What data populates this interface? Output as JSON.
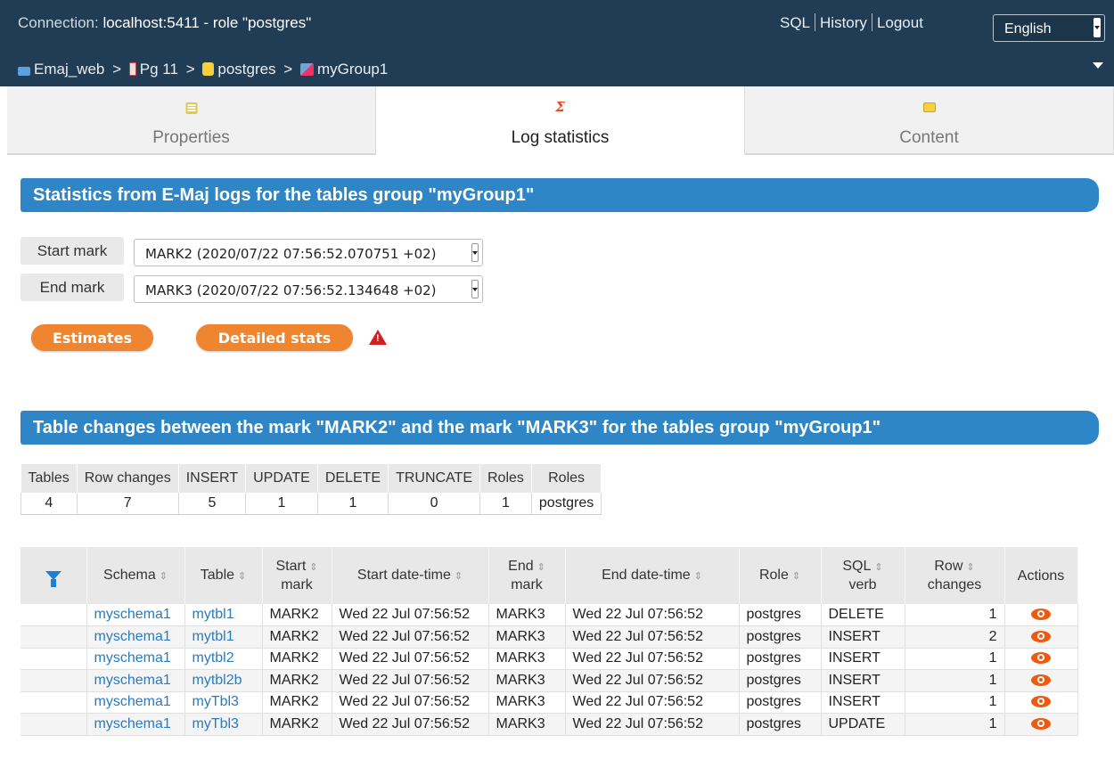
{
  "topbar": {
    "connection_prefix": "Connection: ",
    "connection_host": "localhost:5411",
    "connection_role": " - role \"postgres\"",
    "links": [
      "SQL",
      "History",
      "Logout"
    ],
    "language": "English"
  },
  "breadcrumb": {
    "items": [
      "Emaj_web",
      "Pg 11",
      "postgres",
      "myGroup1"
    ],
    "separator": ">"
  },
  "tabs": [
    {
      "label": "Properties"
    },
    {
      "label": "Log statistics"
    },
    {
      "label": "Content"
    }
  ],
  "stats_section": {
    "title": "Statistics from E-Maj logs for the tables group \"myGroup1\"",
    "start_mark_label": "Start mark",
    "start_mark_value": "MARK2 (2020/07/22 07:56:52.070751 +02)",
    "end_mark_label": "End mark",
    "end_mark_value": "MARK3 (2020/07/22 07:56:52.134648 +02)",
    "estimates_button": "Estimates",
    "detailed_button": "Detailed stats",
    "warning_icon": "warning-icon"
  },
  "changes_section": {
    "title": "Table changes between the mark \"MARK2\" and the mark \"MARK3\" for the tables group \"myGroup1\""
  },
  "summary": {
    "headers": [
      "Tables",
      "Row changes",
      "INSERT",
      "UPDATE",
      "DELETE",
      "TRUNCATE",
      "Roles",
      "Roles"
    ],
    "values": [
      "4",
      "7",
      "5",
      "1",
      "1",
      "0",
      "1",
      "postgres"
    ]
  },
  "detail": {
    "headers": {
      "schema": "Schema",
      "table": "Table",
      "start_mark_1": "Start",
      "start_mark_2": "mark",
      "start_dt": "Start date-time",
      "end_mark_1": "End",
      "end_mark_2": "mark",
      "end_dt": "End date-time",
      "role": "Role",
      "verb_1": "SQL",
      "verb_2": "verb",
      "changes_1": "Row",
      "changes_2": "changes",
      "actions": "Actions"
    },
    "rows": [
      {
        "schema": "myschema1",
        "table": "mytbl1",
        "start_mark": "MARK2",
        "start_dt": "Wed 22 Jul 07:56:52",
        "end_mark": "MARK3",
        "end_dt": "Wed 22 Jul 07:56:52",
        "role": "postgres",
        "verb": "DELETE",
        "changes": "1"
      },
      {
        "schema": "myschema1",
        "table": "mytbl1",
        "start_mark": "MARK2",
        "start_dt": "Wed 22 Jul 07:56:52",
        "end_mark": "MARK3",
        "end_dt": "Wed 22 Jul 07:56:52",
        "role": "postgres",
        "verb": "INSERT",
        "changes": "2"
      },
      {
        "schema": "myschema1",
        "table": "mytbl2",
        "start_mark": "MARK2",
        "start_dt": "Wed 22 Jul 07:56:52",
        "end_mark": "MARK3",
        "end_dt": "Wed 22 Jul 07:56:52",
        "role": "postgres",
        "verb": "INSERT",
        "changes": "1"
      },
      {
        "schema": "myschema1",
        "table": "mytbl2b",
        "start_mark": "MARK2",
        "start_dt": "Wed 22 Jul 07:56:52",
        "end_mark": "MARK3",
        "end_dt": "Wed 22 Jul 07:56:52",
        "role": "postgres",
        "verb": "INSERT",
        "changes": "1"
      },
      {
        "schema": "myschema1",
        "table": "myTbl3",
        "start_mark": "MARK2",
        "start_dt": "Wed 22 Jul 07:56:52",
        "end_mark": "MARK3",
        "end_dt": "Wed 22 Jul 07:56:52",
        "role": "postgres",
        "verb": "INSERT",
        "changes": "1"
      },
      {
        "schema": "myschema1",
        "table": "myTbl3",
        "start_mark": "MARK2",
        "start_dt": "Wed 22 Jul 07:56:52",
        "end_mark": "MARK3",
        "end_dt": "Wed 22 Jul 07:56:52",
        "role": "postgres",
        "verb": "UPDATE",
        "changes": "1"
      }
    ]
  },
  "colors": {
    "topbar": "#203d55",
    "banner": "#2f86c7",
    "button": "#f08530",
    "link": "#2b7bbf",
    "eye": "#ee5a10"
  }
}
